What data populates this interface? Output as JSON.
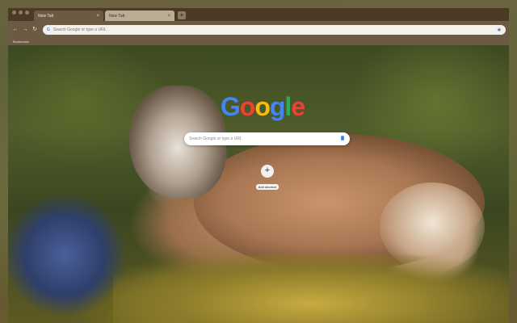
{
  "browser": {
    "tabs": [
      {
        "label": "New Tab",
        "active": true
      },
      {
        "label": "New Tab",
        "active": false
      }
    ],
    "new_tab_symbol": "+",
    "close_symbol": "×",
    "nav": {
      "back_icon": "arrow-left-icon",
      "forward_icon": "arrow-right-icon",
      "reload_icon": "reload-icon"
    },
    "omnibox": {
      "placeholder": "Search Google or type a URL",
      "star_icon": "star-icon"
    },
    "bookmarks_label": "Bookmarks"
  },
  "ntp": {
    "logo_letters": [
      {
        "ch": "G",
        "color": "#4285f4"
      },
      {
        "ch": "o",
        "color": "#ea4335"
      },
      {
        "ch": "o",
        "color": "#fbbc05"
      },
      {
        "ch": "g",
        "color": "#4285f4"
      },
      {
        "ch": "l",
        "color": "#34a853"
      },
      {
        "ch": "e",
        "color": "#ea4335"
      }
    ],
    "search_placeholder": "Search Google or type a URL",
    "shortcut": {
      "symbol": "+",
      "label": "Add shortcut"
    }
  },
  "theme": {
    "frame": "#4a3a26",
    "toolbar": "#6b5a44",
    "inactive_tab": "#b9ad96"
  }
}
